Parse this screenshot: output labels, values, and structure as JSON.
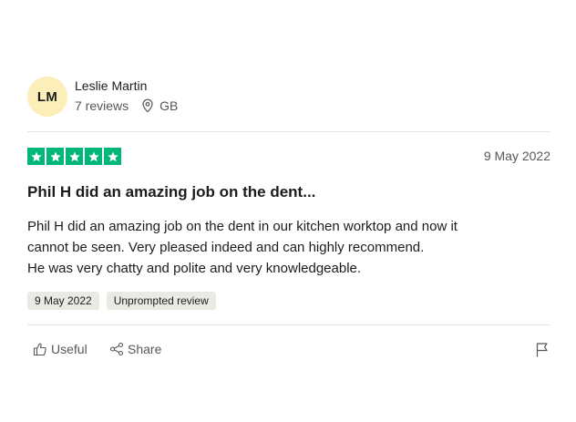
{
  "reviewer": {
    "initials": "LM",
    "name": "Leslie Martin",
    "reviews_count": "7 reviews",
    "country": "GB",
    "avatar_color": "#fbeeb8"
  },
  "review": {
    "rating": 5,
    "rating_max": 5,
    "star_color": "#00b67a",
    "date": "9 May 2022",
    "title": "Phil H did an amazing job on the dent...",
    "body": "Phil H did an amazing job on the dent in our kitchen worktop and now it\ncannot be seen. Very pleased indeed and can highly recommend.\nHe was very chatty and polite and very knowledgeable.",
    "badges": {
      "date": "9 May 2022",
      "type": "Unprompted review"
    }
  },
  "actions": {
    "useful_label": "Useful",
    "share_label": "Share",
    "useful_icon": "thumbs-up-icon",
    "share_icon": "share-icon",
    "report_icon": "flag-icon",
    "location_icon": "location-pin-icon"
  }
}
